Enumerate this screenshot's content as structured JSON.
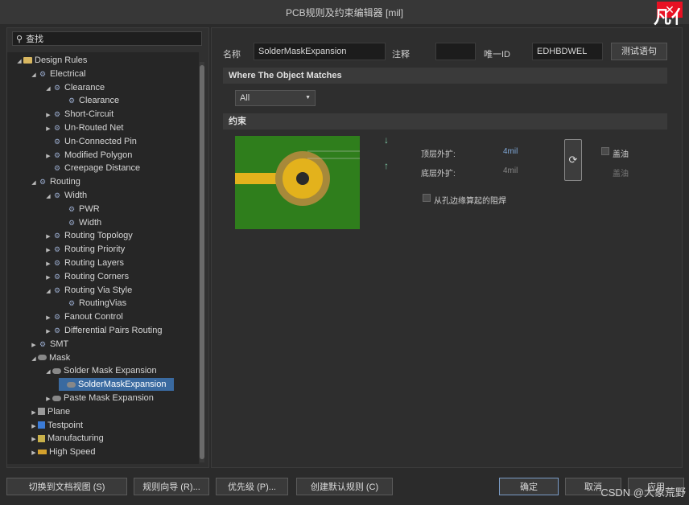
{
  "window": {
    "title": "PCB规则及约束编辑器 [mil]",
    "close": "✕",
    "corner_text": "凡亻"
  },
  "search": {
    "placeholder": "查找"
  },
  "tree": [
    {
      "label": "Design Rules",
      "depth": 0,
      "toggle": "open",
      "icon": "folder"
    },
    {
      "label": "Electrical",
      "depth": 1,
      "toggle": "open",
      "icon": "rule"
    },
    {
      "label": "Clearance",
      "depth": 2,
      "toggle": "open",
      "icon": "rule"
    },
    {
      "label": "Clearance",
      "depth": 3,
      "toggle": "",
      "icon": "rule"
    },
    {
      "label": "Short-Circuit",
      "depth": 2,
      "toggle": "closed",
      "icon": "rule"
    },
    {
      "label": "Un-Routed Net",
      "depth": 2,
      "toggle": "closed",
      "icon": "rule"
    },
    {
      "label": "Un-Connected Pin",
      "depth": 2,
      "toggle": "",
      "icon": "rule"
    },
    {
      "label": "Modified Polygon",
      "depth": 2,
      "toggle": "closed",
      "icon": "rule"
    },
    {
      "label": "Creepage Distance",
      "depth": 2,
      "toggle": "",
      "icon": "rule"
    },
    {
      "label": "Routing",
      "depth": 1,
      "toggle": "open",
      "icon": "rule"
    },
    {
      "label": "Width",
      "depth": 2,
      "toggle": "open",
      "icon": "rule"
    },
    {
      "label": "PWR",
      "depth": 3,
      "toggle": "",
      "icon": "rule"
    },
    {
      "label": "Width",
      "depth": 3,
      "toggle": "",
      "icon": "rule"
    },
    {
      "label": "Routing Topology",
      "depth": 2,
      "toggle": "closed",
      "icon": "rule"
    },
    {
      "label": "Routing Priority",
      "depth": 2,
      "toggle": "closed",
      "icon": "rule"
    },
    {
      "label": "Routing Layers",
      "depth": 2,
      "toggle": "closed",
      "icon": "rule"
    },
    {
      "label": "Routing Corners",
      "depth": 2,
      "toggle": "closed",
      "icon": "rule"
    },
    {
      "label": "Routing Via Style",
      "depth": 2,
      "toggle": "open",
      "icon": "rule"
    },
    {
      "label": "RoutingVias",
      "depth": 3,
      "toggle": "",
      "icon": "rule"
    },
    {
      "label": "Fanout Control",
      "depth": 2,
      "toggle": "closed",
      "icon": "rule"
    },
    {
      "label": "Differential Pairs Routing",
      "depth": 2,
      "toggle": "closed",
      "icon": "rule"
    },
    {
      "label": "SMT",
      "depth": 1,
      "toggle": "closed",
      "icon": "rule"
    },
    {
      "label": "Mask",
      "depth": 1,
      "toggle": "open",
      "icon": "mask"
    },
    {
      "label": "Solder Mask Expansion",
      "depth": 2,
      "toggle": "open",
      "icon": "mask"
    },
    {
      "label": "SolderMaskExpansion",
      "depth": 3,
      "toggle": "",
      "icon": "mask",
      "selected": true
    },
    {
      "label": "Paste Mask Expansion",
      "depth": 2,
      "toggle": "closed",
      "icon": "mask"
    },
    {
      "label": "Plane",
      "depth": 1,
      "toggle": "closed",
      "icon": "plane"
    },
    {
      "label": "Testpoint",
      "depth": 1,
      "toggle": "closed",
      "icon": "test"
    },
    {
      "label": "Manufacturing",
      "depth": 1,
      "toggle": "closed",
      "icon": "mfg"
    },
    {
      "label": "High Speed",
      "depth": 1,
      "toggle": "closed",
      "icon": "hs"
    }
  ],
  "rule": {
    "name_label": "名称",
    "name_value": "SolderMaskExpansion",
    "comment_label": "注释",
    "comment_value": "",
    "uid_label": "唯一ID",
    "uid_value": "EDHBDWEL",
    "test_button": "测试语句"
  },
  "where": {
    "title": "Where The Object Matches",
    "selection": "All"
  },
  "constraints": {
    "title": "约束",
    "top_label": "顶层外扩:",
    "top_value": "4mil",
    "bottom_label": "底层外扩:",
    "bottom_value": "4mil",
    "tent_top": "盖油",
    "tent_bottom": "盖油",
    "from_hole_edge": "从孔边缘算起的阻焊",
    "link_symbol": "⟳"
  },
  "footer": {
    "switch_view": "切换到文档视图 (S)",
    "rule_wizard": "规则向导 (R)...",
    "priority": "优先级 (P)...",
    "create_default": "创建默认规则 (C)",
    "ok": "确定",
    "cancel": "取消",
    "apply": "应用"
  },
  "watermark": "CSDN @大象荒野",
  "colors": {
    "pcb_green": "#2d7d1a",
    "pad_copper": "#e3b21c",
    "mask_ring": "#a58a3a",
    "accent": "#3a6aa0"
  }
}
